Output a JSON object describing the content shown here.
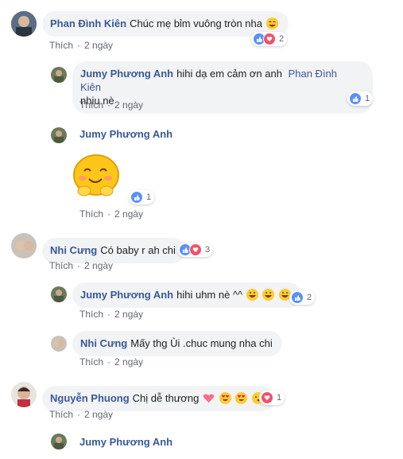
{
  "comments": [
    {
      "author": "Phan Đình Kiên",
      "text": "Chúc mẹ bỉm vuông tròn nha",
      "like_label": "Thích",
      "time": "2 ngày",
      "reaction_count": "2"
    },
    {
      "author": "Jumy Phương Anh",
      "text": "hihi dạ em cảm ơn anh",
      "mention": "Phan Đình Kiên",
      "text_after": "nhiu nè",
      "like_label": "Thích",
      "time": "2 ngày",
      "reaction_count": "1"
    },
    {
      "author": "Jumy Phương Anh",
      "like_label": "Thích",
      "time": "2 ngày",
      "reaction_count": "1"
    },
    {
      "author": "Nhi Cưng",
      "text": "Có baby r ah chi",
      "like_label": "Thích",
      "time": "2 ngày",
      "reaction_count": "3"
    },
    {
      "author": "Jumy Phương Anh",
      "text": "hihi uhm nè ^^",
      "like_label": "Thích",
      "time": "2 ngày",
      "reaction_count": "2"
    },
    {
      "author": "Nhi Cưng",
      "text": "Mấy thg Ùi .chuc mung nha chi",
      "like_label": "Thích",
      "time": "2 ngày"
    },
    {
      "author": "Nguyễn Phuong",
      "text": "Chị dễ thương",
      "like_label": "Thích",
      "time": "2 ngày",
      "reaction_count": "1"
    },
    {
      "author": "Jumy Phương Anh"
    }
  ],
  "colors": {
    "link": "#385898",
    "bubble": "#f2f3f5",
    "like": "#5890ff",
    "love": "#f25268",
    "meta": "#616770"
  },
  "icons": [
    "like-icon",
    "love-icon",
    "laugh-emoji-icon",
    "heart-eyes-emoji-icon",
    "heart-emoji-icon",
    "kiss-emoji-icon",
    "sticker-icon"
  ]
}
